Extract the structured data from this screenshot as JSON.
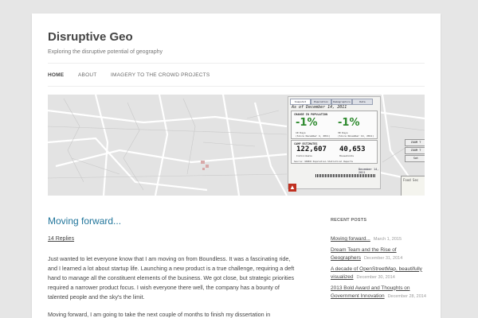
{
  "site": {
    "title": "Disruptive Geo",
    "description": "Exploring the disruptive potential of geography"
  },
  "nav": {
    "items": [
      {
        "label": "HOME",
        "active": true
      },
      {
        "label": "ABOUT",
        "active": false
      },
      {
        "label": "IMAGERY TO THE CROWD PROJECTS",
        "active": false
      }
    ]
  },
  "banner": {
    "tabs": [
      "Snapshot",
      "Population",
      "Demographics",
      "Data"
    ],
    "as_of": "As of December 14, 2011",
    "change_heading": "CHANGE IN POPULATION",
    "change": [
      {
        "value": "-1%",
        "label_1": "10 Days",
        "label_2": "(Since December 4, 2011)"
      },
      {
        "value": "-1%",
        "label_1": "30 Days",
        "label_2": "(Since November 14, 2011)"
      }
    ],
    "estimates_heading": "CAMP ESTIMATES",
    "estimates": [
      {
        "value": "122,607",
        "label": "Individuals"
      },
      {
        "value": "40,653",
        "label": "Households"
      }
    ],
    "source": "Source: UNHCR Population Statistical Reports",
    "timeline_date": "December 14, 2011",
    "right_buttons": [
      "ZOOM T",
      "ZOOM T",
      "Sat"
    ],
    "food_label": "Food Sec",
    "colors": {
      "map_bg": "#e3e3e3",
      "road": "#ffffff",
      "green": "#2e8a2e"
    }
  },
  "post": {
    "title": "Moving forward...",
    "replies": "14 Replies",
    "paragraphs": [
      "Just wanted to let everyone know that I am moving on from Boundless. It was a fascinating ride, and I learned a lot about startup life. Launching a new product is a true challenge, requiring a deft hand to manage all the constituent elements of the business. We got close, but strategic priorities required a narrower product focus. I wish everyone there well, the company has a bounty of talented people and the sky's the limit.",
      "Moving forward, I am going to take the next couple of months to finish my dissertation in"
    ]
  },
  "sidebar": {
    "heading": "RECENT POSTS",
    "posts": [
      {
        "title": "Moving forward...",
        "date": "March 1, 2015"
      },
      {
        "title": "Dream Team and the Rise of Geographers",
        "date": "December 31, 2014"
      },
      {
        "title": "A decade of OpenStreetMap, beautifully visualized",
        "date": "December 30, 2014"
      },
      {
        "title": "2013 Bold Award and Thoughts on Government Innovation",
        "date": "December 28, 2014"
      }
    ]
  },
  "colors": {
    "link": "#21759b",
    "background": "#e6e6e6",
    "text": "#444444"
  }
}
